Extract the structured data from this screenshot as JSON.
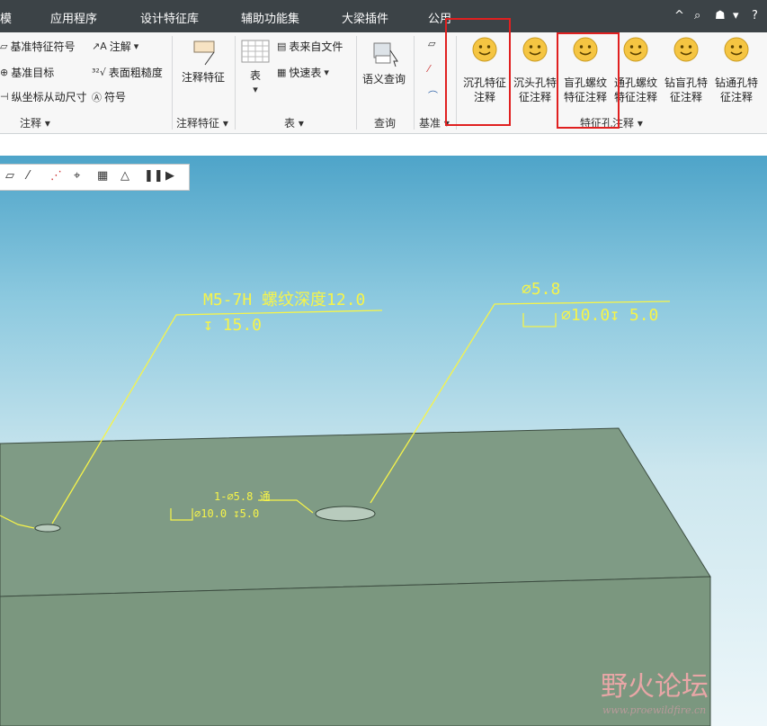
{
  "menubar": {
    "items": [
      "模",
      "应用程序",
      "设计特征库",
      "辅助功能集",
      "大梁插件",
      "公用"
    ],
    "right_icons": [
      "^",
      "⌕",
      "☗",
      "▾",
      "?"
    ]
  },
  "ribbon": {
    "annotation_group": {
      "items": [
        "基准特征符号",
        "注解",
        "基准目标",
        "表面粗糙度",
        "纵坐标从动尺寸",
        "符号"
      ],
      "label": "注释"
    },
    "annotation_feature_group": {
      "button": "注释特征",
      "label": "注释特征"
    },
    "table_group": {
      "button": "表",
      "from_file": "表来自文件",
      "quick_table": "快速表",
      "label": "表"
    },
    "query_group": {
      "button": "语义查询",
      "label": "查询"
    },
    "datum_group": {
      "label": "基准"
    },
    "hole_group": {
      "buttons": [
        {
          "line1": "沉孔特征",
          "line2": "注释"
        },
        {
          "line1": "沉头孔特",
          "line2": "征注释"
        },
        {
          "line1": "盲孔螺纹",
          "line2": "特征注释"
        },
        {
          "line1": "通孔螺纹",
          "line2": "特征注释"
        },
        {
          "line1": "钻盲孔特",
          "line2": "征注释"
        },
        {
          "line1": "钻通孔特",
          "line2": "征注释"
        }
      ],
      "label": "特征孔注释"
    }
  },
  "viewport": {
    "annotations": {
      "left_line1": "M5-7H 螺纹深度12.0",
      "left_line2": "↧ 15.0",
      "right_line1": "⌀5.8",
      "right_line2": "⌀10.0↧ 5.0",
      "small_line1": "1-⌀5.8 通",
      "small_line2": "⌀10.0 ↧5.0"
    },
    "watermark": {
      "brand": "野火论坛",
      "url": "www.proewildfire.cn"
    }
  },
  "colors": {
    "menubar": "#3c4347",
    "annotation": "#f6f44a",
    "highlight_box": "#e02020",
    "part": "#7e9a84"
  }
}
